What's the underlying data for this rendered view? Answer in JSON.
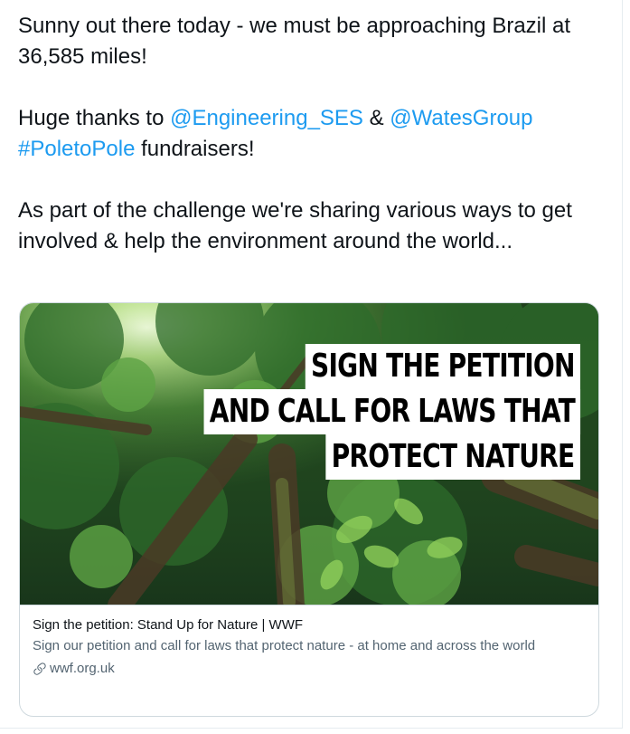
{
  "tweet": {
    "line1": "Sunny out there today - we must be approaching Brazil at 36,585 miles!",
    "thanks_prefix": "Huge thanks to ",
    "mention1": "@Engineering_SES",
    "amp": " & ",
    "mention2": "@WatesGroup",
    "hashtag": "#PoletoPole",
    "thanks_suffix": " fundraisers!",
    "line3": "As part of the challenge we're sharing various ways to get involved & help the environment around the world..."
  },
  "card": {
    "image_text": [
      "SIGN THE PETITION",
      "AND CALL FOR LAWS THAT",
      "PROTECT NATURE"
    ],
    "title": "Sign the petition: Stand Up for Nature | WWF",
    "description": "Sign our petition and call for laws that protect nature - at home and across the world",
    "domain": "wwf.org.uk",
    "domain_icon": "link-icon"
  },
  "colors": {
    "link": "#1d9bf0",
    "text": "#0f1419",
    "secondary": "#536471",
    "border": "#cfd9de"
  }
}
